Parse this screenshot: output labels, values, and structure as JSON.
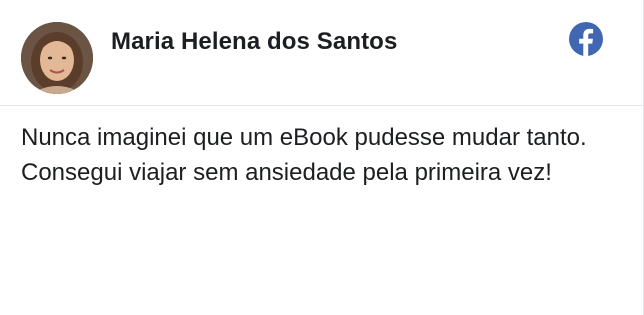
{
  "review": {
    "author_name": "Maria Helena dos Santos",
    "text": "Nunca imaginei que um eBook pudesse mudar tanto. Consegui viajar sem ansiedade pela primeira vez!",
    "source_icon": "facebook-icon"
  },
  "colors": {
    "facebook_blue": "#4267B2",
    "divider": "#e4e6eb",
    "text": "#1c1e21"
  }
}
